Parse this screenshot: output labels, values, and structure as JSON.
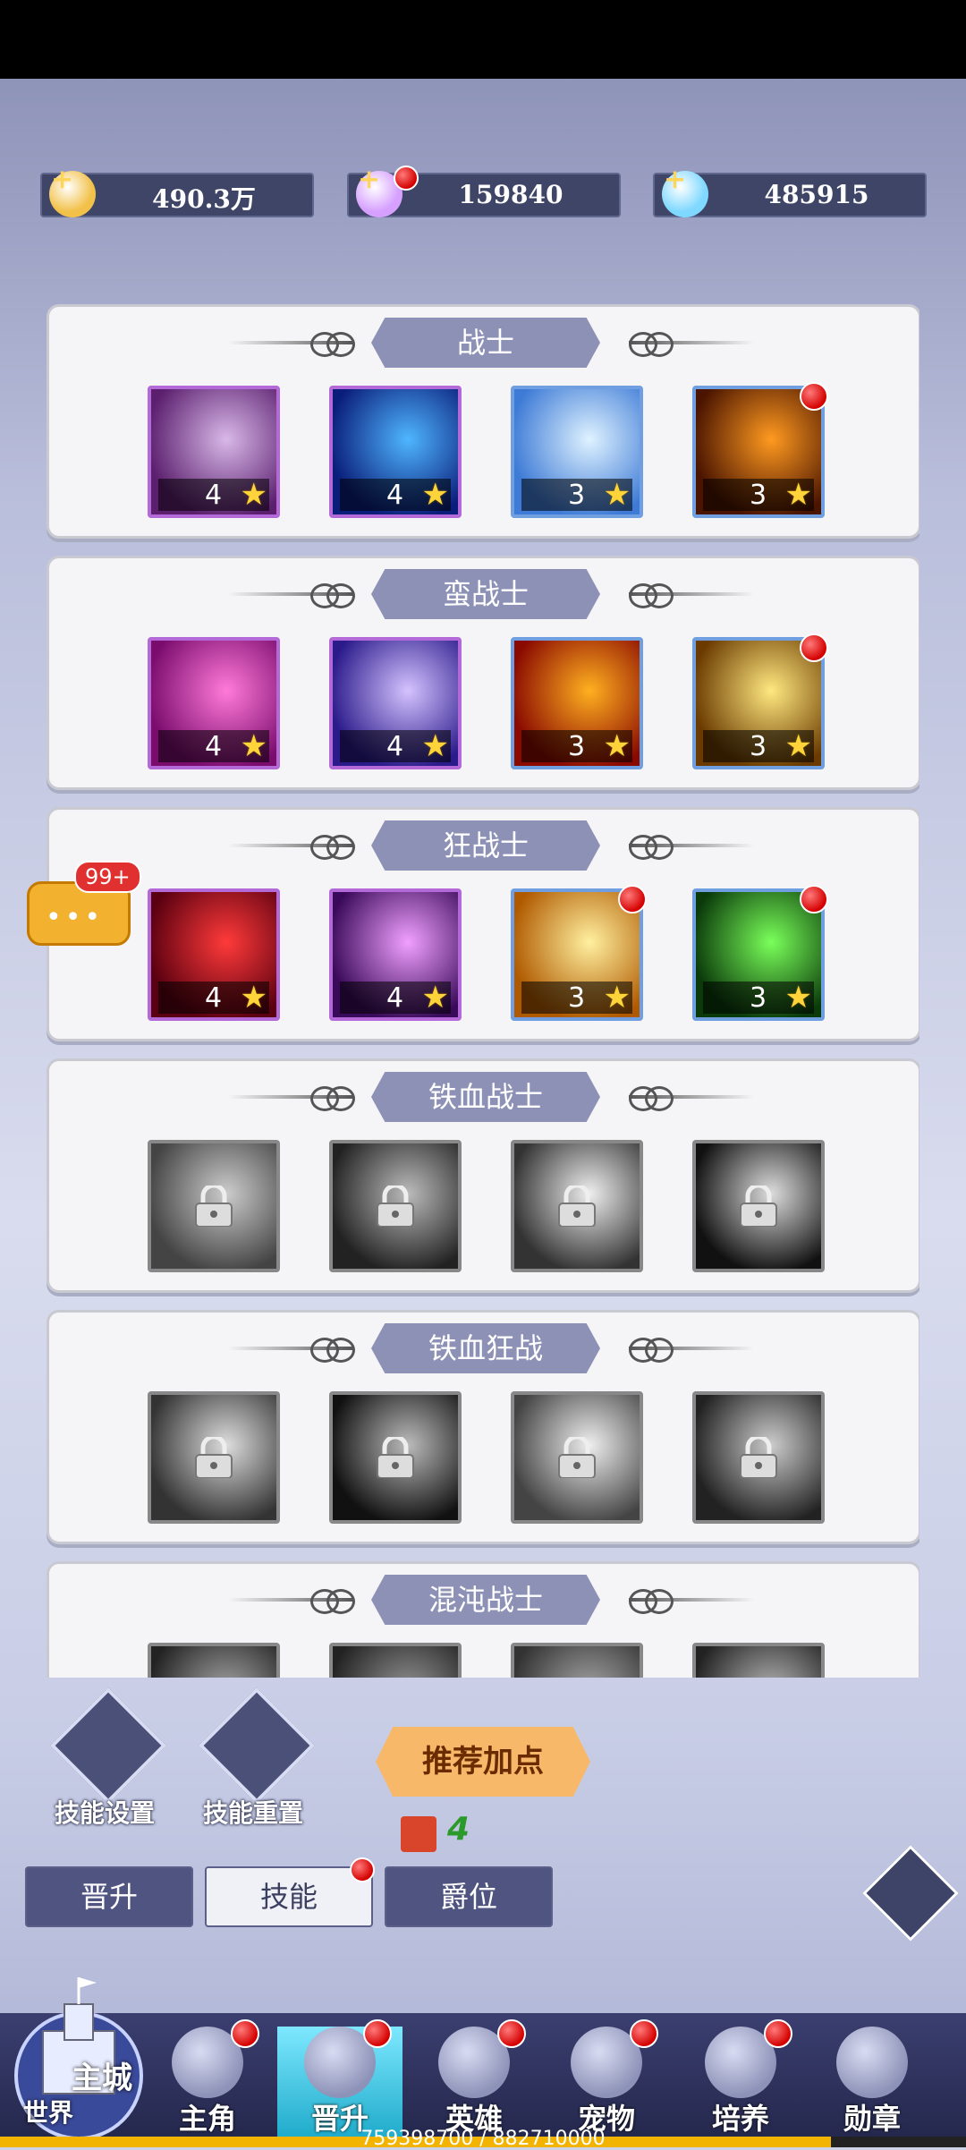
{
  "currency": [
    {
      "icon": "gold-coin-icon",
      "value": "490.3万",
      "plus": "+",
      "badge": false
    },
    {
      "icon": "crystal-icon",
      "value": "159840",
      "plus": "+",
      "badge": true
    },
    {
      "icon": "diamond-icon",
      "value": "485915",
      "plus": "+",
      "badge": false
    }
  ],
  "panels": [
    {
      "title": "战士",
      "skills": [
        {
          "locked": false,
          "frame": "purple",
          "level": "4",
          "badge": false,
          "c1": "#5b1f6e",
          "c2": "#d8b8e8"
        },
        {
          "locked": false,
          "frame": "purple",
          "level": "4",
          "badge": false,
          "c1": "#0a1d7a",
          "c2": "#4fb6ff"
        },
        {
          "locked": false,
          "frame": "blue",
          "level": "3",
          "badge": false,
          "c1": "#3e7bd6",
          "c2": "#dff2ff"
        },
        {
          "locked": false,
          "frame": "blue",
          "level": "3",
          "badge": true,
          "c1": "#4a1400",
          "c2": "#ff9a20"
        }
      ]
    },
    {
      "title": "蛮战士",
      "skills": [
        {
          "locked": false,
          "frame": "purple",
          "level": "4",
          "badge": false,
          "c1": "#7a0c6e",
          "c2": "#ff7ad8"
        },
        {
          "locked": false,
          "frame": "purple",
          "level": "4",
          "badge": false,
          "c1": "#2a1a8a",
          "c2": "#d4c2ff"
        },
        {
          "locked": false,
          "frame": "blue",
          "level": "3",
          "badge": false,
          "c1": "#8a0a00",
          "c2": "#ffb020"
        },
        {
          "locked": false,
          "frame": "blue",
          "level": "3",
          "badge": true,
          "c1": "#6a3a00",
          "c2": "#ffe880"
        }
      ]
    },
    {
      "title": "狂战士",
      "skills": [
        {
          "locked": false,
          "frame": "purple",
          "level": "4",
          "badge": false,
          "c1": "#5a0010",
          "c2": "#ff3a3a"
        },
        {
          "locked": false,
          "frame": "purple",
          "level": "4",
          "badge": false,
          "c1": "#3a0a5a",
          "c2": "#f0a0ff"
        },
        {
          "locked": false,
          "frame": "blue",
          "level": "3",
          "badge": true,
          "c1": "#b05a00",
          "c2": "#fff0a0"
        },
        {
          "locked": false,
          "frame": "blue",
          "level": "3",
          "badge": true,
          "c1": "#0a3a0a",
          "c2": "#7aff5a"
        }
      ]
    },
    {
      "title": "铁血战士",
      "skills": [
        {
          "locked": true,
          "frame": "grey",
          "level": "",
          "badge": false,
          "c1": "#444",
          "c2": "#ccc"
        },
        {
          "locked": true,
          "frame": "grey",
          "level": "",
          "badge": false,
          "c1": "#222",
          "c2": "#bbb"
        },
        {
          "locked": true,
          "frame": "grey",
          "level": "",
          "badge": false,
          "c1": "#333",
          "c2": "#eee"
        },
        {
          "locked": true,
          "frame": "grey",
          "level": "",
          "badge": false,
          "c1": "#111",
          "c2": "#ddd"
        }
      ]
    },
    {
      "title": "铁血狂战",
      "skills": [
        {
          "locked": true,
          "frame": "grey",
          "level": "",
          "badge": false,
          "c1": "#333",
          "c2": "#ddd"
        },
        {
          "locked": true,
          "frame": "grey",
          "level": "",
          "badge": false,
          "c1": "#111",
          "c2": "#bbb"
        },
        {
          "locked": true,
          "frame": "grey",
          "level": "",
          "badge": false,
          "c1": "#444",
          "c2": "#eee"
        },
        {
          "locked": true,
          "frame": "grey",
          "level": "",
          "badge": false,
          "c1": "#222",
          "c2": "#ccc"
        }
      ]
    },
    {
      "title": "混沌战士",
      "skills": [
        {
          "locked": true,
          "frame": "grey",
          "level": "",
          "badge": false,
          "c1": "#222",
          "c2": "#aaa"
        },
        {
          "locked": true,
          "frame": "grey",
          "level": "",
          "badge": false,
          "c1": "#222",
          "c2": "#999"
        },
        {
          "locked": true,
          "frame": "grey",
          "level": "",
          "badge": false,
          "c1": "#333",
          "c2": "#aaa"
        },
        {
          "locked": true,
          "frame": "grey",
          "level": "",
          "badge": false,
          "c1": "#222",
          "c2": "#bbb"
        }
      ]
    }
  ],
  "chat": {
    "badge": "99+",
    "dots": "•••"
  },
  "tools": {
    "skill_settings": "技能设置",
    "skill_reset": "技能重置",
    "recommend": "推荐加点",
    "book_count": "4"
  },
  "tabs": [
    {
      "label": "晋升",
      "active": false,
      "badge": false
    },
    {
      "label": "技能",
      "active": true,
      "badge": true
    },
    {
      "label": "爵位",
      "active": false,
      "badge": false
    }
  ],
  "nav": [
    {
      "label": "主角",
      "icon": "hero-icon",
      "badge": true,
      "active": false
    },
    {
      "label": "晋升",
      "icon": "promote-icon",
      "badge": true,
      "active": true
    },
    {
      "label": "英雄",
      "icon": "knight-icon",
      "badge": true,
      "active": false
    },
    {
      "label": "宠物",
      "icon": "pet-icon",
      "badge": true,
      "active": false
    },
    {
      "label": "培养",
      "icon": "train-icon",
      "badge": true,
      "active": false
    },
    {
      "label": "勋章",
      "icon": "medal-icon",
      "badge": false,
      "active": false
    }
  ],
  "castle": {
    "main": "主城",
    "world": "世界"
  },
  "progress": {
    "text": "759398700 / 882710000",
    "fraction": 0.86
  }
}
